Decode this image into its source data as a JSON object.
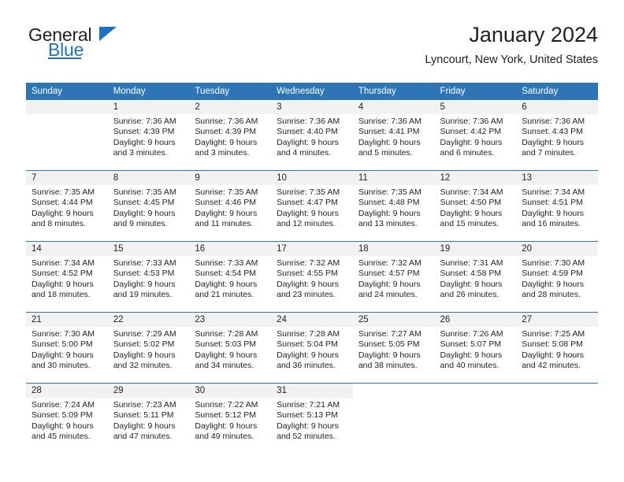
{
  "brand": {
    "name_top": "General",
    "name_bottom": "Blue",
    "triangle_icon": "triangle-icon"
  },
  "header": {
    "title": "January 2024",
    "subtitle": "Lyncourt, New York, United States"
  },
  "colors": {
    "header_blue": "#2e75b6",
    "brand_blue": "#1e73be",
    "daynum_bg": "#f2f2f2",
    "text": "#231f20"
  },
  "weekdays": [
    "Sunday",
    "Monday",
    "Tuesday",
    "Wednesday",
    "Thursday",
    "Friday",
    "Saturday"
  ],
  "weeks": [
    [
      {
        "day": "",
        "lines": []
      },
      {
        "day": "1",
        "lines": [
          "Sunrise: 7:36 AM",
          "Sunset: 4:39 PM",
          "Daylight: 9 hours",
          "and 3 minutes."
        ]
      },
      {
        "day": "2",
        "lines": [
          "Sunrise: 7:36 AM",
          "Sunset: 4:39 PM",
          "Daylight: 9 hours",
          "and 3 minutes."
        ]
      },
      {
        "day": "3",
        "lines": [
          "Sunrise: 7:36 AM",
          "Sunset: 4:40 PM",
          "Daylight: 9 hours",
          "and 4 minutes."
        ]
      },
      {
        "day": "4",
        "lines": [
          "Sunrise: 7:36 AM",
          "Sunset: 4:41 PM",
          "Daylight: 9 hours",
          "and 5 minutes."
        ]
      },
      {
        "day": "5",
        "lines": [
          "Sunrise: 7:36 AM",
          "Sunset: 4:42 PM",
          "Daylight: 9 hours",
          "and 6 minutes."
        ]
      },
      {
        "day": "6",
        "lines": [
          "Sunrise: 7:36 AM",
          "Sunset: 4:43 PM",
          "Daylight: 9 hours",
          "and 7 minutes."
        ]
      }
    ],
    [
      {
        "day": "7",
        "lines": [
          "Sunrise: 7:35 AM",
          "Sunset: 4:44 PM",
          "Daylight: 9 hours",
          "and 8 minutes."
        ]
      },
      {
        "day": "8",
        "lines": [
          "Sunrise: 7:35 AM",
          "Sunset: 4:45 PM",
          "Daylight: 9 hours",
          "and 9 minutes."
        ]
      },
      {
        "day": "9",
        "lines": [
          "Sunrise: 7:35 AM",
          "Sunset: 4:46 PM",
          "Daylight: 9 hours",
          "and 11 minutes."
        ]
      },
      {
        "day": "10",
        "lines": [
          "Sunrise: 7:35 AM",
          "Sunset: 4:47 PM",
          "Daylight: 9 hours",
          "and 12 minutes."
        ]
      },
      {
        "day": "11",
        "lines": [
          "Sunrise: 7:35 AM",
          "Sunset: 4:48 PM",
          "Daylight: 9 hours",
          "and 13 minutes."
        ]
      },
      {
        "day": "12",
        "lines": [
          "Sunrise: 7:34 AM",
          "Sunset: 4:50 PM",
          "Daylight: 9 hours",
          "and 15 minutes."
        ]
      },
      {
        "day": "13",
        "lines": [
          "Sunrise: 7:34 AM",
          "Sunset: 4:51 PM",
          "Daylight: 9 hours",
          "and 16 minutes."
        ]
      }
    ],
    [
      {
        "day": "14",
        "lines": [
          "Sunrise: 7:34 AM",
          "Sunset: 4:52 PM",
          "Daylight: 9 hours",
          "and 18 minutes."
        ]
      },
      {
        "day": "15",
        "lines": [
          "Sunrise: 7:33 AM",
          "Sunset: 4:53 PM",
          "Daylight: 9 hours",
          "and 19 minutes."
        ]
      },
      {
        "day": "16",
        "lines": [
          "Sunrise: 7:33 AM",
          "Sunset: 4:54 PM",
          "Daylight: 9 hours",
          "and 21 minutes."
        ]
      },
      {
        "day": "17",
        "lines": [
          "Sunrise: 7:32 AM",
          "Sunset: 4:55 PM",
          "Daylight: 9 hours",
          "and 23 minutes."
        ]
      },
      {
        "day": "18",
        "lines": [
          "Sunrise: 7:32 AM",
          "Sunset: 4:57 PM",
          "Daylight: 9 hours",
          "and 24 minutes."
        ]
      },
      {
        "day": "19",
        "lines": [
          "Sunrise: 7:31 AM",
          "Sunset: 4:58 PM",
          "Daylight: 9 hours",
          "and 26 minutes."
        ]
      },
      {
        "day": "20",
        "lines": [
          "Sunrise: 7:30 AM",
          "Sunset: 4:59 PM",
          "Daylight: 9 hours",
          "and 28 minutes."
        ]
      }
    ],
    [
      {
        "day": "21",
        "lines": [
          "Sunrise: 7:30 AM",
          "Sunset: 5:00 PM",
          "Daylight: 9 hours",
          "and 30 minutes."
        ]
      },
      {
        "day": "22",
        "lines": [
          "Sunrise: 7:29 AM",
          "Sunset: 5:02 PM",
          "Daylight: 9 hours",
          "and 32 minutes."
        ]
      },
      {
        "day": "23",
        "lines": [
          "Sunrise: 7:28 AM",
          "Sunset: 5:03 PM",
          "Daylight: 9 hours",
          "and 34 minutes."
        ]
      },
      {
        "day": "24",
        "lines": [
          "Sunrise: 7:28 AM",
          "Sunset: 5:04 PM",
          "Daylight: 9 hours",
          "and 36 minutes."
        ]
      },
      {
        "day": "25",
        "lines": [
          "Sunrise: 7:27 AM",
          "Sunset: 5:05 PM",
          "Daylight: 9 hours",
          "and 38 minutes."
        ]
      },
      {
        "day": "26",
        "lines": [
          "Sunrise: 7:26 AM",
          "Sunset: 5:07 PM",
          "Daylight: 9 hours",
          "and 40 minutes."
        ]
      },
      {
        "day": "27",
        "lines": [
          "Sunrise: 7:25 AM",
          "Sunset: 5:08 PM",
          "Daylight: 9 hours",
          "and 42 minutes."
        ]
      }
    ],
    [
      {
        "day": "28",
        "lines": [
          "Sunrise: 7:24 AM",
          "Sunset: 5:09 PM",
          "Daylight: 9 hours",
          "and 45 minutes."
        ]
      },
      {
        "day": "29",
        "lines": [
          "Sunrise: 7:23 AM",
          "Sunset: 5:11 PM",
          "Daylight: 9 hours",
          "and 47 minutes."
        ]
      },
      {
        "day": "30",
        "lines": [
          "Sunrise: 7:22 AM",
          "Sunset: 5:12 PM",
          "Daylight: 9 hours",
          "and 49 minutes."
        ]
      },
      {
        "day": "31",
        "lines": [
          "Sunrise: 7:21 AM",
          "Sunset: 5:13 PM",
          "Daylight: 9 hours",
          "and 52 minutes."
        ]
      },
      {
        "day": "",
        "lines": []
      },
      {
        "day": "",
        "lines": []
      },
      {
        "day": "",
        "lines": []
      }
    ]
  ]
}
